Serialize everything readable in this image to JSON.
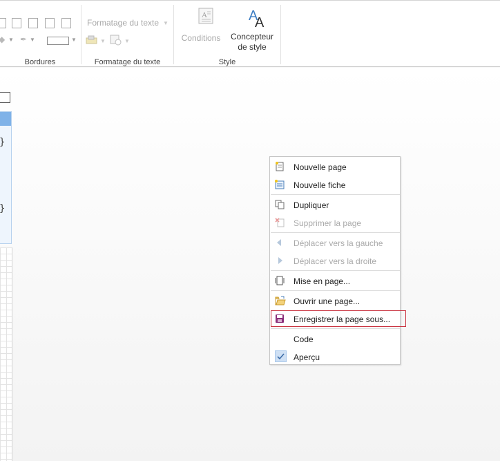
{
  "ribbon": {
    "groups": {
      "borders": {
        "label": "Bordures"
      },
      "text_format": {
        "label": "Formatage du texte",
        "dropdown_label": "Formatage du texte"
      },
      "style": {
        "label": "Style"
      }
    },
    "conditions_label": "Conditions",
    "style_designer_line1": "Concepteur",
    "style_designer_line2": "de style"
  },
  "context_menu": {
    "items": [
      {
        "label": "Nouvelle page",
        "icon": "new-page-icon",
        "enabled": true
      },
      {
        "label": "Nouvelle fiche",
        "icon": "new-form-icon",
        "enabled": true
      },
      {
        "label": "Dupliquer",
        "icon": "duplicate-icon",
        "enabled": true
      },
      {
        "label": "Supprimer la page",
        "icon": "delete-page-icon",
        "enabled": false
      },
      {
        "label": "Déplacer vers la gauche",
        "icon": "arrow-left-icon",
        "enabled": false
      },
      {
        "label": "Déplacer vers la droite",
        "icon": "arrow-right-icon",
        "enabled": false
      },
      {
        "label": "Mise en page...",
        "icon": "page-setup-icon",
        "enabled": true
      },
      {
        "label": "Ouvrir une page...",
        "icon": "open-folder-icon",
        "enabled": true
      },
      {
        "label": "Enregistrer la page sous...",
        "icon": "save-icon",
        "enabled": true,
        "highlighted": true
      },
      {
        "label": "Code",
        "icon": "",
        "enabled": true
      },
      {
        "label": "Aperçu",
        "icon": "check-icon",
        "enabled": true,
        "checked": true
      }
    ]
  },
  "colors": {
    "accent_blue": "#7fb2e8",
    "highlight_border": "#c9313e",
    "save_icon": "#8b2f7a"
  }
}
